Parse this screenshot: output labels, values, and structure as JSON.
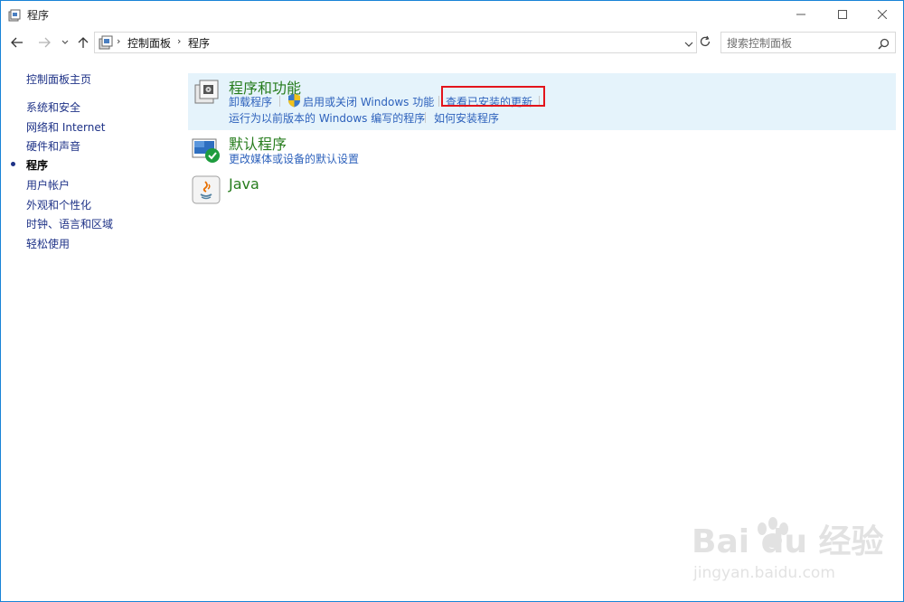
{
  "window": {
    "title": "程序"
  },
  "nav": {
    "breadcrumb": [
      "控制面板",
      "程序"
    ],
    "search_placeholder": "搜索控制面板"
  },
  "sidebar": {
    "items": [
      {
        "label": "控制面板主页"
      },
      {
        "label": "系统和安全"
      },
      {
        "label": "网络和 Internet"
      },
      {
        "label": "硬件和声音"
      },
      {
        "label": "程序",
        "current": true
      },
      {
        "label": "用户帐户"
      },
      {
        "label": "外观和个性化"
      },
      {
        "label": "时钟、语言和区域"
      },
      {
        "label": "轻松使用"
      }
    ]
  },
  "categories": [
    {
      "title": "程序和功能",
      "links": [
        "卸载程序",
        "启用或关闭 Windows 功能",
        "查看已安装的更新",
        "运行为以前版本的 Windows 编写的程序",
        "如何安装程序"
      ],
      "icon": "programs-features-icon"
    },
    {
      "title": "默认程序",
      "links": [
        "更改媒体或设备的默认设置"
      ],
      "icon": "default-programs-icon"
    },
    {
      "title": "Java",
      "links": [],
      "icon": "java-icon"
    }
  ],
  "watermark": {
    "text": "Bai du 经验",
    "url": "jingyan.baidu.com"
  },
  "colors": {
    "link": "#2e62bc",
    "category_title": "#267c1c",
    "highlight_bg": "#e5f3fb",
    "annotation_box": "#e3141b",
    "window_border": "#1883d7"
  }
}
